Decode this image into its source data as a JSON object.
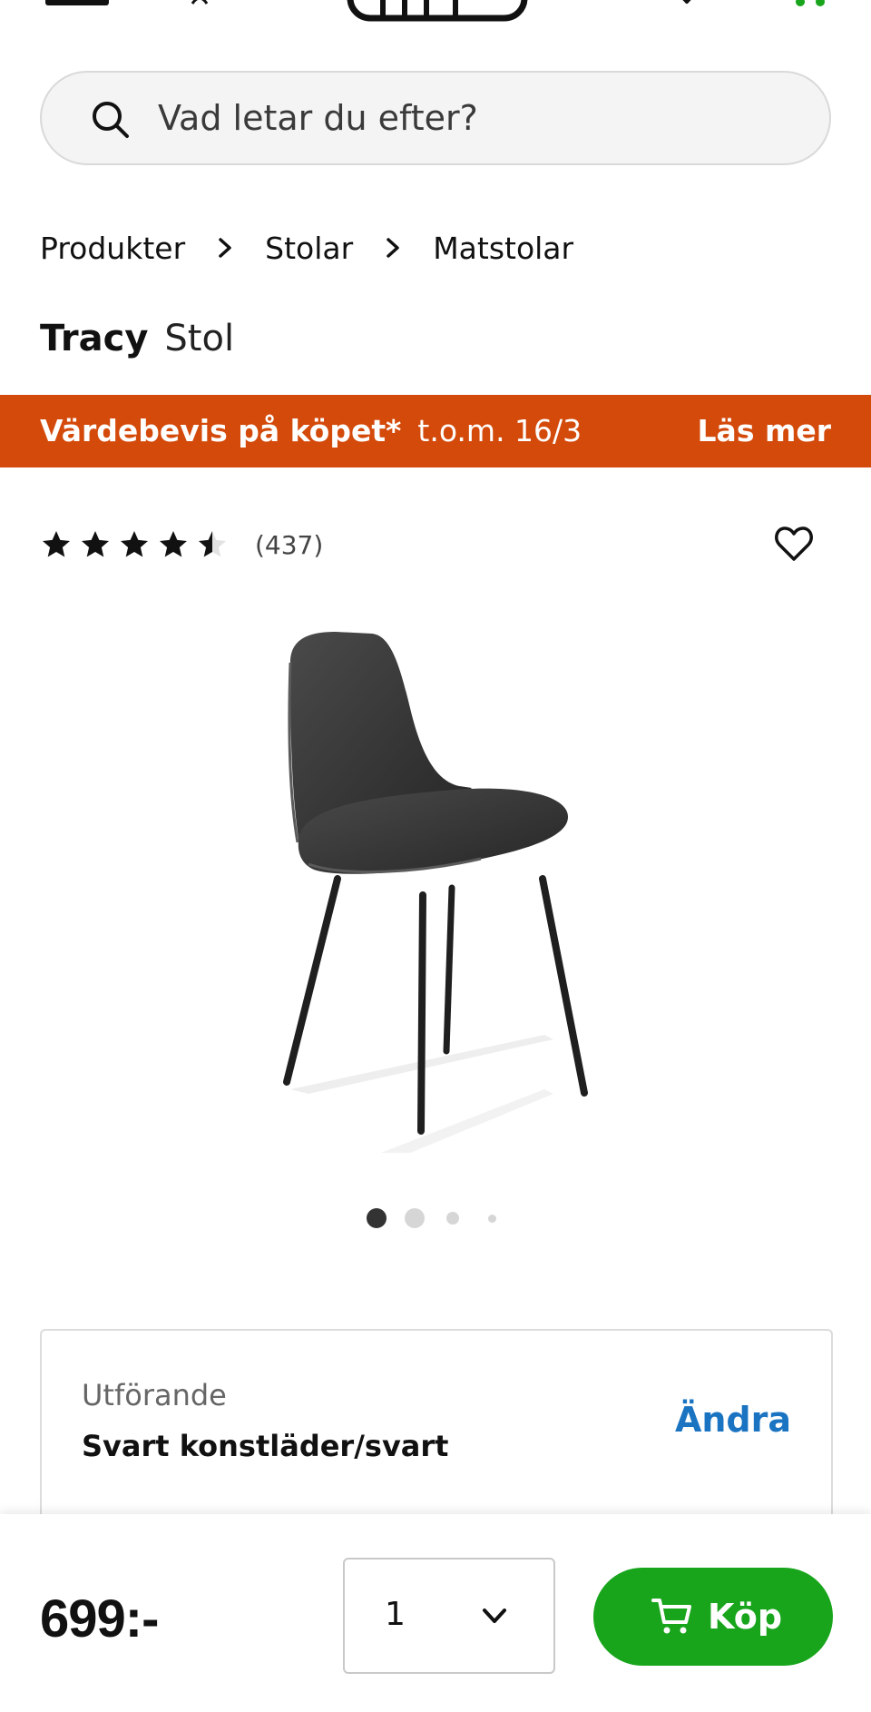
{
  "header": {
    "menu_icon": "menu-icon",
    "account_icon": "account-icon",
    "logo_icon": "store-logo",
    "wishlist_icon": "heart-icon",
    "cart_icon": "cart-icon",
    "accent": "#18a51c"
  },
  "search": {
    "placeholder": "Vad letar du efter?",
    "icon": "search-icon"
  },
  "breadcrumb": {
    "items": [
      "Produkter",
      "Stolar",
      "Matstolar"
    ]
  },
  "product": {
    "name": "Tracy",
    "type": "Stol",
    "rating": 4.5,
    "rating_count": "(437)",
    "image_alt": "chair",
    "gallery_pages": 4,
    "gallery_active": 1
  },
  "promo": {
    "title": "Värdebevis på köpet*",
    "date": "t.o.m. 16/3",
    "link": "Läs mer",
    "color": "#d44a0b"
  },
  "variant": {
    "label": "Utförande",
    "value": "Svart konstläder/svart",
    "change": "Ändra"
  },
  "purchase": {
    "price": "699:-",
    "quantity": "1",
    "buy_label": "Köp",
    "buy_color": "#18a51c"
  }
}
